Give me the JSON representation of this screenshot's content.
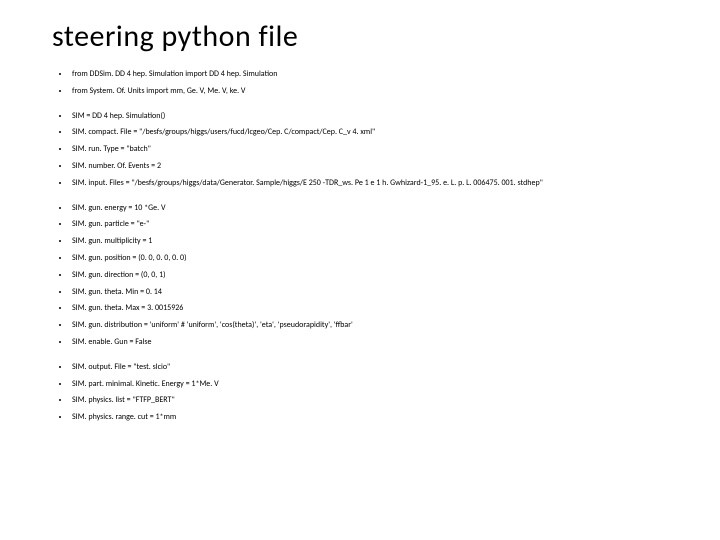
{
  "title": "steering python file",
  "blocks": [
    [
      "from DDSim. DD 4 hep. Simulation import DD 4 hep. Simulation",
      "from System. Of. Units import mm, Ge. V, Me. V, ke. V"
    ],
    [
      "SIM = DD 4 hep. Simulation()",
      "SIM. compact. File = \"/besfs/groups/higgs/users/fucd/lcgeo/Cep. C/compact/Cep. C_v 4. xml\"",
      "SIM. run. Type = \"batch\"",
      "SIM. number. Of. Events = 2",
      "SIM. input. Files = \"/besfs/groups/higgs/data/Generator. Sample/higgs/E 250 -TDR_ws. Pe 1 e 1 h. Gwhizard-1_95. e. L. p. L. 006475. 001. stdhep\""
    ],
    [
      "SIM. gun. energy = 10 *Ge. V",
      "SIM. gun. particle = \"e-\"",
      "SIM. gun. multiplicity = 1",
      "SIM. gun. position = (0. 0, 0. 0, 0. 0)",
      "SIM. gun. direction = (0, 0, 1)",
      "SIM. gun. theta. Min = 0. 14",
      "SIM. gun. theta. Max = 3. 0015926",
      "SIM. gun. distribution = 'uniform'       # 'uniform', 'cos(theta)', 'eta', 'pseudorapidity', 'ffbar'",
      "SIM. enable. Gun = False"
    ],
    [
      "SIM. output. File = \"test. slcio\"",
      "SIM. part. minimal. Kinetic. Energy = 1*Me. V",
      "SIM. physics. list = \"FTFP_BERT\"",
      "SIM. physics. range. cut = 1*mm"
    ]
  ]
}
